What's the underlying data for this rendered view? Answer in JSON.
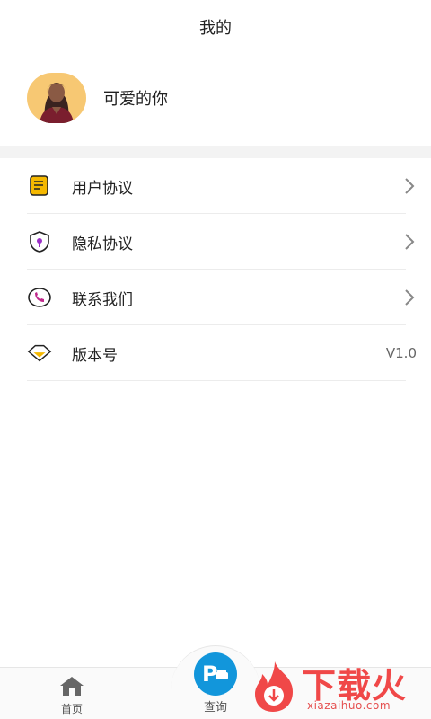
{
  "header": {
    "title": "我的"
  },
  "profile": {
    "name": "可爱的你"
  },
  "menu": {
    "items": [
      {
        "label": "用户协议",
        "icon": "document-icon"
      },
      {
        "label": "隐私协议",
        "icon": "shield-lock-icon"
      },
      {
        "label": "联系我们",
        "icon": "phone-icon"
      },
      {
        "label": "版本号",
        "icon": "diamond-icon",
        "value": "V1.0"
      }
    ]
  },
  "tabbar": {
    "home_label": "首页",
    "search_label": "查询"
  },
  "watermark": {
    "brand": "下载火",
    "url": "xiazaihuo.com"
  },
  "colors": {
    "accent": "#1296db",
    "avatar_bg": "#f7c873",
    "icon_yellow": "#f5b800",
    "icon_purple": "#9b30c8",
    "watermark_red": "#f04848"
  }
}
